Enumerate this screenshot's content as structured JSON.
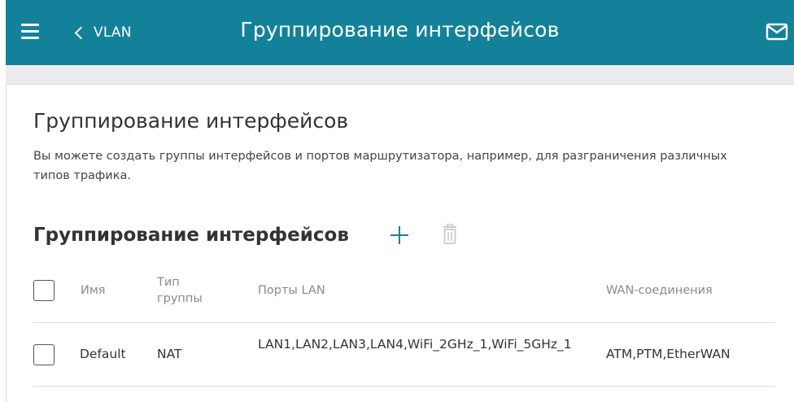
{
  "header": {
    "back_label": "VLAN",
    "title": "Группирование интерфейсов"
  },
  "page": {
    "title": "Группирование интерфейсов",
    "description": "Вы можете создать группы интерфейсов и портов маршрутизатора, например, для разграничения различных типов трафика."
  },
  "section": {
    "title": "Группирование интерфейсов"
  },
  "table": {
    "headers": {
      "name": "Имя",
      "type": "Тип группы",
      "lan_ports": "Порты LAN",
      "wan": "WAN-соединения"
    },
    "rows": [
      {
        "name": "Default",
        "type": "NAT",
        "lan_ports": "LAN1,LAN2,LAN3,LAN4,WiFi_2GHz_1,WiFi_5GHz_1",
        "wan": "ATM,PTM,EtherWAN"
      }
    ]
  },
  "colors": {
    "header_bg": "#14819a",
    "accent": "#14819a"
  },
  "icons": [
    "menu-icon",
    "chevron-left-icon",
    "mail-icon",
    "plus-icon",
    "trash-icon"
  ]
}
